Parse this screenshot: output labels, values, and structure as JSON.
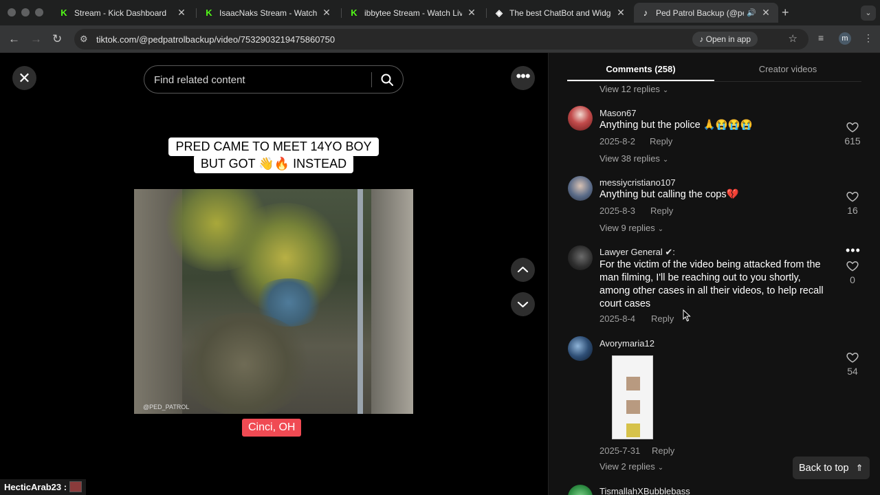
{
  "browser": {
    "tabs": [
      {
        "title": "Stream - Kick Dashboard",
        "favicon": "kick-icon",
        "active": false
      },
      {
        "title": "IsaacNaks Stream - Watch Live",
        "favicon": "kick-icon",
        "active": false
      },
      {
        "title": "ibbytee Stream - Watch Live o",
        "favicon": "kick-icon",
        "active": false
      },
      {
        "title": "The best ChatBot and Widget",
        "favicon": "diamond-icon",
        "active": false
      },
      {
        "title": "Ped Patrol Backup (@ped",
        "favicon": "tiktok-icon",
        "active": true
      }
    ],
    "url": "tiktok.com/@pedpatrolbackup/video/7532903219475860750",
    "open_in_app": "Open in app",
    "profile_initial": "m"
  },
  "video": {
    "search_placeholder": "Find related content",
    "caption_line1": "PRED CAME TO MEET 14YO BOY",
    "caption_line2": "BUT GOT 👋🔥 INSTEAD",
    "watermark": "@PED_PATROL",
    "location": "Cinci, OH"
  },
  "stream_overlay": {
    "chat_user": "HecticArab23 :"
  },
  "comments_panel": {
    "tab_comments": "Comments (258)",
    "tab_creator": "Creator videos",
    "top_replies": "View 12 replies",
    "comments": [
      {
        "user": "Mason67",
        "text": "Anything but the police 🙏😭😭😭",
        "date": "2025-8-2",
        "reply": "Reply",
        "likes": "615",
        "replies": "View 38 replies"
      },
      {
        "user": "messiycristiano107",
        "text": "Anything but calling the cops💔",
        "date": "2025-8-3",
        "reply": "Reply",
        "likes": "16",
        "replies": "View 9 replies"
      },
      {
        "user": "Lawyer General ✔:",
        "text": "For the victim of the video being attacked from the man filming, I'll be reaching out to you shortly, among other cases in all their videos, to help recall court cases",
        "date": "2025-8-4",
        "reply": "Reply",
        "likes": "0"
      },
      {
        "user": "Avorymaria12",
        "text": "",
        "date": "2025-7-31",
        "reply": "Reply",
        "likes": "54",
        "replies": "View 2 replies"
      },
      {
        "user": "TismallahXBubblebass"
      }
    ],
    "back_to_top": "Back to top"
  }
}
